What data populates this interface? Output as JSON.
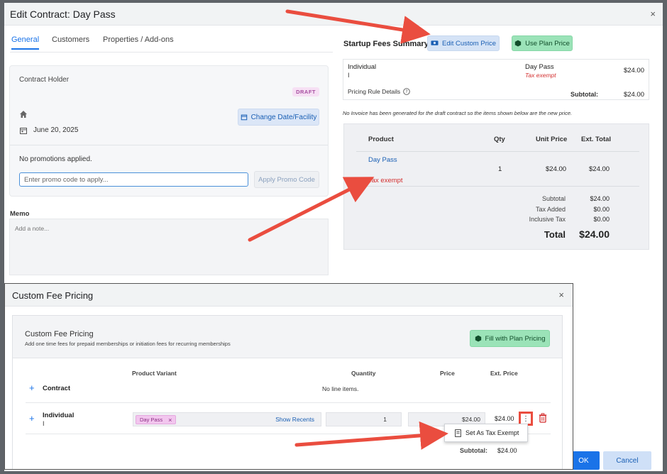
{
  "main_modal": {
    "title": "Edit Contract: Day Pass",
    "close": "×",
    "tabs": [
      {
        "label": "General"
      },
      {
        "label": "Customers"
      },
      {
        "label": "Properties / Add-ons"
      }
    ],
    "contract_holder": {
      "label": "Contract Holder",
      "status_badge": "DRAFT",
      "date": "June 20, 2025",
      "change_button": "Change Date/Facility"
    },
    "promo": {
      "status": "No promotions applied.",
      "placeholder": "Enter promo code to apply...",
      "apply_button": "Apply Promo Code"
    },
    "memo": {
      "label": "Memo",
      "placeholder": "Add a note..."
    },
    "startup_fees": {
      "title": "Startup Fees Summary",
      "edit_button": "Edit Custom Price",
      "plan_button": "Use Plan Price",
      "row_name": "Individual",
      "row_sub": "I",
      "item": "Day Pass",
      "item_note": "Tax exempt",
      "amount": "$24.00",
      "pricing_link": "Pricing Rule Details",
      "subtotal_label": "Subtotal:",
      "subtotal_value": "$24.00"
    },
    "notice": "No Invoice has been generated for the draft contract so the items shown below are the new price.",
    "invoice": {
      "headers": {
        "product": "Product",
        "qty": "Qty",
        "unit": "Unit Price",
        "ext": "Ext. Total"
      },
      "row": {
        "product": "Day Pass",
        "qty": "1",
        "unit": "$24.00",
        "ext": "$24.00",
        "note": "Tax exempt"
      },
      "totals": {
        "subtotal_label": "Subtotal",
        "subtotal": "$24.00",
        "tax_label": "Tax Added",
        "tax": "$0.00",
        "incl_label": "Inclusive Tax",
        "incl": "$0.00",
        "total_label": "Total",
        "total": "$24.00"
      }
    },
    "footer": {
      "ok": "OK",
      "cancel": "Cancel"
    }
  },
  "fee_modal": {
    "title": "Custom Fee Pricing",
    "close": "×",
    "panel_title": "Custom Fee Pricing",
    "panel_subtitle": "Add one time fees for prepaid memberships or initiation fees for recurring memberships",
    "fill_button": "Fill with Plan Pricing",
    "headers": {
      "variant": "Product Variant",
      "qty": "Quantity",
      "price": "Price",
      "ext": "Ext. Price"
    },
    "contract_label": "Contract",
    "no_items": "No line items.",
    "individual_label": "Individual",
    "individual_sub": "I",
    "chip": "Day Pass",
    "chip_remove": "×",
    "show_recents": "Show Recents",
    "quantity": "1",
    "price": "$24.00",
    "ext_price": "$24.00",
    "kebab": "⋮",
    "menu_item": "Set As Tax Exempt",
    "subtotal_label": "Subtotal:",
    "subtotal_value": "$24.00",
    "plus": "+"
  },
  "colors": {
    "accent": "#1a73e8",
    "success": "#9be3b8",
    "danger": "#d32f2f",
    "annotation": "#ea4d3f"
  }
}
